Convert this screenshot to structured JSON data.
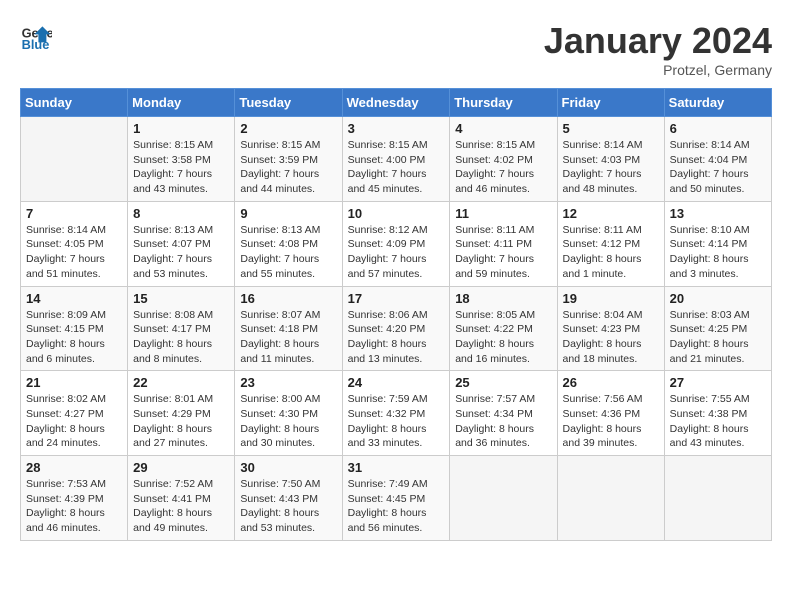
{
  "logo": {
    "line1": "General",
    "line2": "Blue"
  },
  "title": "January 2024",
  "subtitle": "Protzel, Germany",
  "days_header": [
    "Sunday",
    "Monday",
    "Tuesday",
    "Wednesday",
    "Thursday",
    "Friday",
    "Saturday"
  ],
  "weeks": [
    [
      {
        "day": "",
        "info": ""
      },
      {
        "day": "1",
        "info": "Sunrise: 8:15 AM\nSunset: 3:58 PM\nDaylight: 7 hours\nand 43 minutes."
      },
      {
        "day": "2",
        "info": "Sunrise: 8:15 AM\nSunset: 3:59 PM\nDaylight: 7 hours\nand 44 minutes."
      },
      {
        "day": "3",
        "info": "Sunrise: 8:15 AM\nSunset: 4:00 PM\nDaylight: 7 hours\nand 45 minutes."
      },
      {
        "day": "4",
        "info": "Sunrise: 8:15 AM\nSunset: 4:02 PM\nDaylight: 7 hours\nand 46 minutes."
      },
      {
        "day": "5",
        "info": "Sunrise: 8:14 AM\nSunset: 4:03 PM\nDaylight: 7 hours\nand 48 minutes."
      },
      {
        "day": "6",
        "info": "Sunrise: 8:14 AM\nSunset: 4:04 PM\nDaylight: 7 hours\nand 50 minutes."
      }
    ],
    [
      {
        "day": "7",
        "info": "Sunrise: 8:14 AM\nSunset: 4:05 PM\nDaylight: 7 hours\nand 51 minutes."
      },
      {
        "day": "8",
        "info": "Sunrise: 8:13 AM\nSunset: 4:07 PM\nDaylight: 7 hours\nand 53 minutes."
      },
      {
        "day": "9",
        "info": "Sunrise: 8:13 AM\nSunset: 4:08 PM\nDaylight: 7 hours\nand 55 minutes."
      },
      {
        "day": "10",
        "info": "Sunrise: 8:12 AM\nSunset: 4:09 PM\nDaylight: 7 hours\nand 57 minutes."
      },
      {
        "day": "11",
        "info": "Sunrise: 8:11 AM\nSunset: 4:11 PM\nDaylight: 7 hours\nand 59 minutes."
      },
      {
        "day": "12",
        "info": "Sunrise: 8:11 AM\nSunset: 4:12 PM\nDaylight: 8 hours\nand 1 minute."
      },
      {
        "day": "13",
        "info": "Sunrise: 8:10 AM\nSunset: 4:14 PM\nDaylight: 8 hours\nand 3 minutes."
      }
    ],
    [
      {
        "day": "14",
        "info": "Sunrise: 8:09 AM\nSunset: 4:15 PM\nDaylight: 8 hours\nand 6 minutes."
      },
      {
        "day": "15",
        "info": "Sunrise: 8:08 AM\nSunset: 4:17 PM\nDaylight: 8 hours\nand 8 minutes."
      },
      {
        "day": "16",
        "info": "Sunrise: 8:07 AM\nSunset: 4:18 PM\nDaylight: 8 hours\nand 11 minutes."
      },
      {
        "day": "17",
        "info": "Sunrise: 8:06 AM\nSunset: 4:20 PM\nDaylight: 8 hours\nand 13 minutes."
      },
      {
        "day": "18",
        "info": "Sunrise: 8:05 AM\nSunset: 4:22 PM\nDaylight: 8 hours\nand 16 minutes."
      },
      {
        "day": "19",
        "info": "Sunrise: 8:04 AM\nSunset: 4:23 PM\nDaylight: 8 hours\nand 18 minutes."
      },
      {
        "day": "20",
        "info": "Sunrise: 8:03 AM\nSunset: 4:25 PM\nDaylight: 8 hours\nand 21 minutes."
      }
    ],
    [
      {
        "day": "21",
        "info": "Sunrise: 8:02 AM\nSunset: 4:27 PM\nDaylight: 8 hours\nand 24 minutes."
      },
      {
        "day": "22",
        "info": "Sunrise: 8:01 AM\nSunset: 4:29 PM\nDaylight: 8 hours\nand 27 minutes."
      },
      {
        "day": "23",
        "info": "Sunrise: 8:00 AM\nSunset: 4:30 PM\nDaylight: 8 hours\nand 30 minutes."
      },
      {
        "day": "24",
        "info": "Sunrise: 7:59 AM\nSunset: 4:32 PM\nDaylight: 8 hours\nand 33 minutes."
      },
      {
        "day": "25",
        "info": "Sunrise: 7:57 AM\nSunset: 4:34 PM\nDaylight: 8 hours\nand 36 minutes."
      },
      {
        "day": "26",
        "info": "Sunrise: 7:56 AM\nSunset: 4:36 PM\nDaylight: 8 hours\nand 39 minutes."
      },
      {
        "day": "27",
        "info": "Sunrise: 7:55 AM\nSunset: 4:38 PM\nDaylight: 8 hours\nand 43 minutes."
      }
    ],
    [
      {
        "day": "28",
        "info": "Sunrise: 7:53 AM\nSunset: 4:39 PM\nDaylight: 8 hours\nand 46 minutes."
      },
      {
        "day": "29",
        "info": "Sunrise: 7:52 AM\nSunset: 4:41 PM\nDaylight: 8 hours\nand 49 minutes."
      },
      {
        "day": "30",
        "info": "Sunrise: 7:50 AM\nSunset: 4:43 PM\nDaylight: 8 hours\nand 53 minutes."
      },
      {
        "day": "31",
        "info": "Sunrise: 7:49 AM\nSunset: 4:45 PM\nDaylight: 8 hours\nand 56 minutes."
      },
      {
        "day": "",
        "info": ""
      },
      {
        "day": "",
        "info": ""
      },
      {
        "day": "",
        "info": ""
      }
    ]
  ]
}
